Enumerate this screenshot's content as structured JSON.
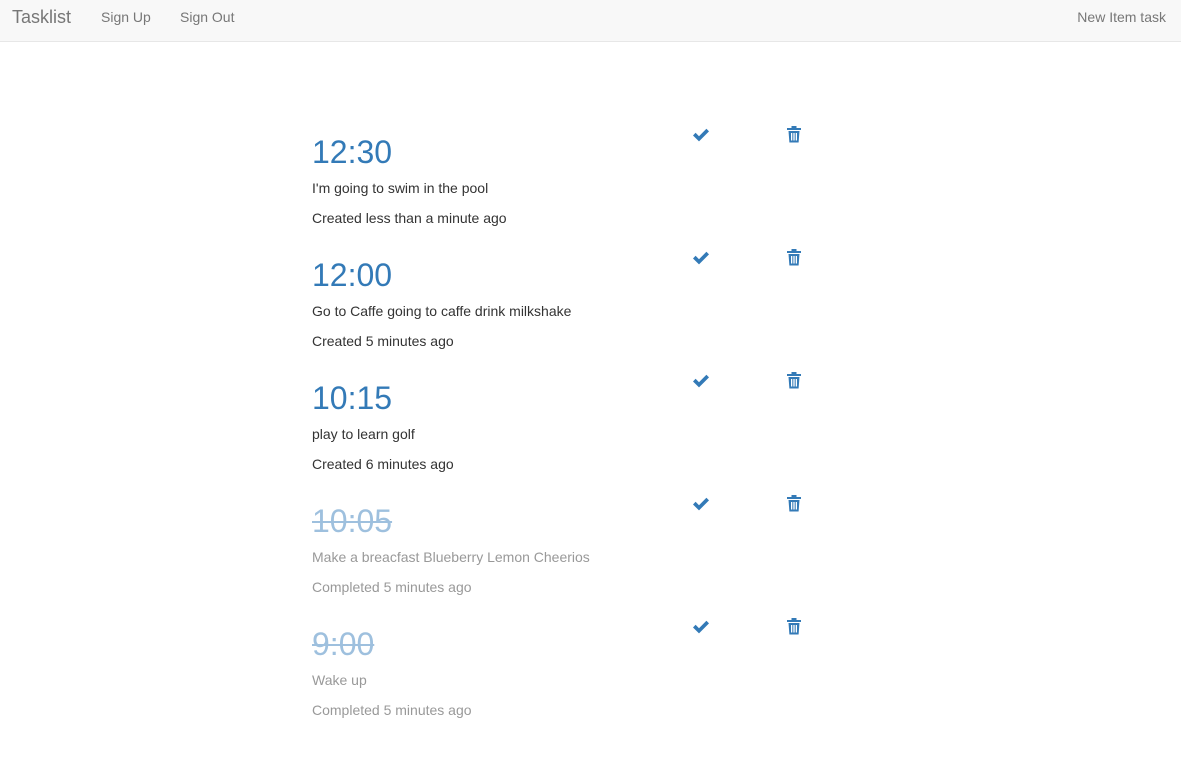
{
  "nav": {
    "brand": "Tasklist",
    "sign_up": "Sign Up",
    "sign_out": "Sign Out",
    "new_item": "New Item task"
  },
  "tasks": [
    {
      "time": "12:30",
      "description": "I'm going to swim in the pool",
      "status_text": "Created less than a minute ago",
      "completed": false
    },
    {
      "time": "12:00",
      "description": "Go to Caffe going to caffe drink milkshake",
      "status_text": "Created 5 minutes ago",
      "completed": false
    },
    {
      "time": "10:15",
      "description": "play to learn golf",
      "status_text": "Created 6 minutes ago",
      "completed": false
    },
    {
      "time": "10:05",
      "description": "Make a breacfast Blueberry Lemon Cheerios",
      "status_text": "Completed 5 minutes ago",
      "completed": true
    },
    {
      "time": "9:00",
      "description": "Wake up",
      "status_text": "Completed 5 minutes ago",
      "completed": true
    }
  ],
  "icons": {
    "complete": "check-icon",
    "delete": "trash-icon"
  },
  "colors": {
    "accent": "#337ab7",
    "completed_time": "#9ec0de",
    "muted_text": "#999999",
    "navbar_bg": "#f8f8f8",
    "navbar_text": "#777777"
  }
}
